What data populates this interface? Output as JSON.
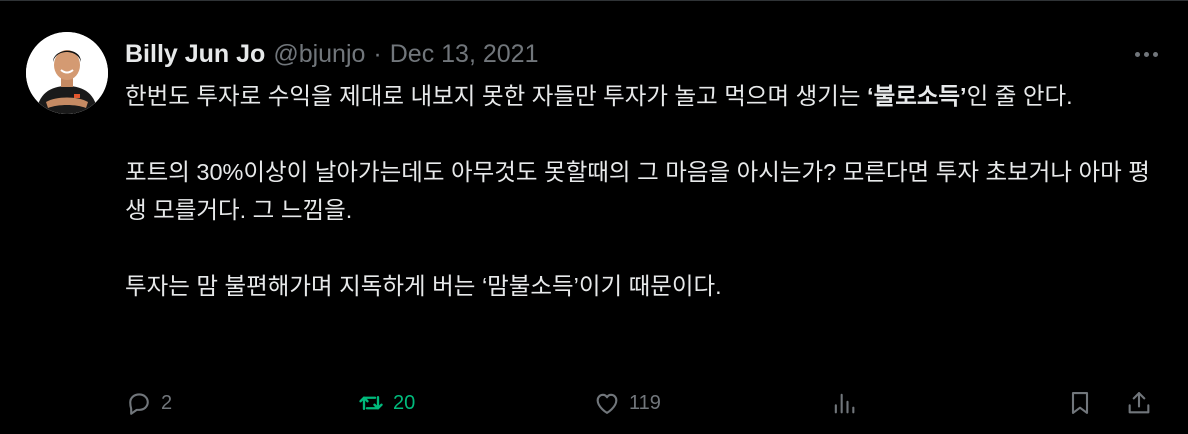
{
  "author": {
    "display_name": "Billy Jun Jo",
    "handle": "@bjunjo",
    "separator": "·",
    "date": "Dec 13, 2021"
  },
  "tweet": {
    "line1_pre": "한번도 투자로 수익을 제대로 내보지 못한 자들만 투자가 놀고 먹으며 생기는 ",
    "line1_bold": "‘불로소득’",
    "line1_post": "인 줄 안다.",
    "paragraph2": "포트의 30%이상이 날아가는데도 아무것도 못할때의 그 마음을 아시는가? 모른다면 투자 초보거나 아마 평생 모를거다. 그 느낌을.",
    "paragraph3": "투자는 맘 불편해가며 지독하게 버는 ‘맘불소득’이기 때문이다."
  },
  "actions": {
    "reply_count": "2",
    "retweet_count": "20",
    "like_count": "119"
  },
  "icons": {
    "reply": "reply-icon",
    "retweet": "retweet-icon",
    "like": "heart-icon",
    "views": "analytics-icon",
    "bookmark": "bookmark-icon",
    "share": "share-icon",
    "more": "more-icon"
  },
  "colors": {
    "background": "#000000",
    "text": "#e7e9ea",
    "muted": "#71767b",
    "retweet_active": "#00ba7c"
  }
}
